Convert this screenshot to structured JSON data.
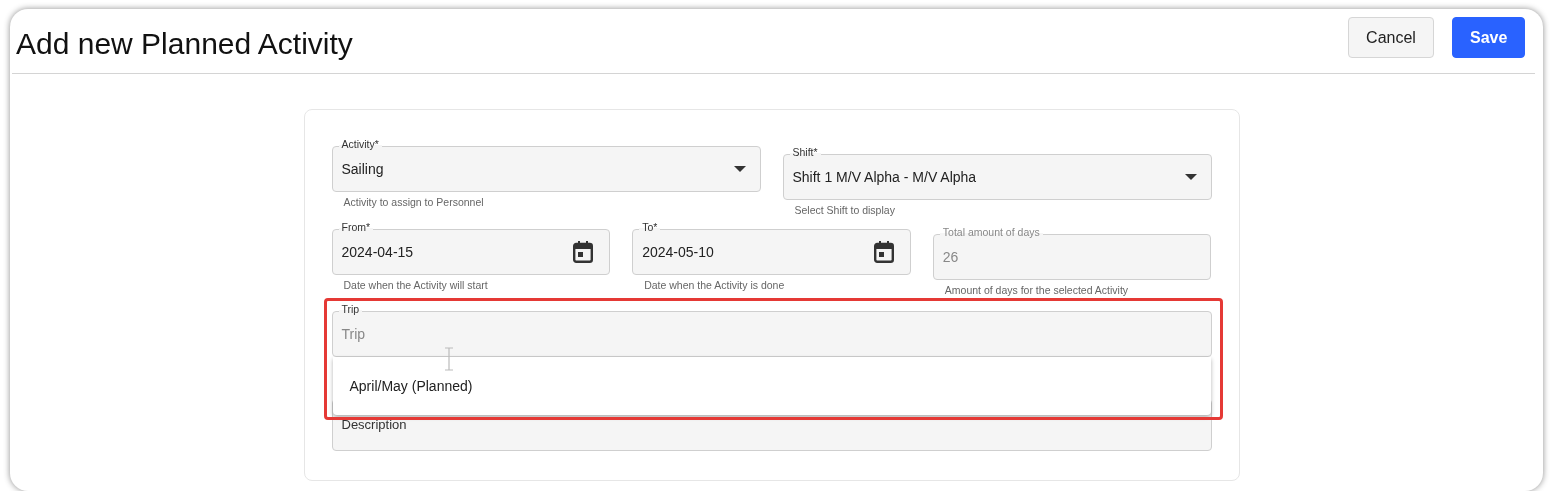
{
  "window": {
    "title": "Add new Planned Activity"
  },
  "buttons": [
    {
      "label": "Cancel",
      "kind": "secondary"
    },
    {
      "label": "Save",
      "kind": "primary"
    }
  ],
  "form": {
    "rows": [
      [
        {
          "kind": "select",
          "label": "Activity*",
          "value": "Sailing",
          "helper": "Activity to assign to Personnel"
        },
        {
          "kind": "select",
          "label": "Shift*",
          "value": "Shift 1 M/V Alpha - M/V Alpha",
          "helper": "Select Shift to display"
        }
      ],
      [
        {
          "kind": "date",
          "label": "From*",
          "value": "2024-04-15",
          "helper": "Date when the Activity will start"
        },
        {
          "kind": "date",
          "label": "To*",
          "value": "2024-05-10",
          "helper": "Date when the Activity is done"
        },
        {
          "kind": "number",
          "label": "Total amount of days",
          "value": "26",
          "disabled": true,
          "helper": "Amount of days for the selected Activity"
        }
      ],
      [
        {
          "kind": "autocomplete",
          "label": "Trip",
          "placeholder": "Trip",
          "highlighted": true,
          "options": [
            {
              "label": "April/May (Planned)",
              "selected": false
            }
          ]
        }
      ],
      [
        {
          "kind": "textarea",
          "label": "Description"
        }
      ]
    ]
  }
}
